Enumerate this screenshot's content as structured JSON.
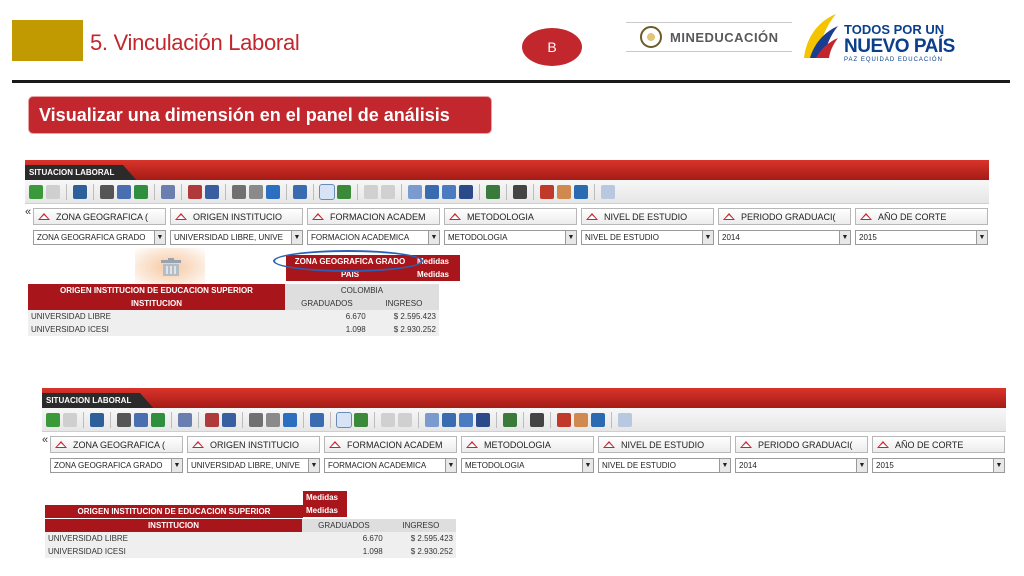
{
  "header": {
    "title": "5. Vinculación Laboral",
    "badge": "B",
    "logo_mineducacion": "MINEDUCACIÓN",
    "logo_tpu_line1": "TODOS POR UN",
    "logo_tpu_line2": "NUEVO PAÍS",
    "logo_tpu_line3": "PAZ  EQUIDAD  EDUCACIÓN"
  },
  "subtitle": "Visualizar una dimensión en el panel de análisis",
  "colors": {
    "accent_red": "#c1272d",
    "gold": "#c09a00",
    "header_dark_red": "#a8151a",
    "highlight_blue": "#2b5fb5"
  },
  "panel": {
    "tab_label": "SITUACION LABORAL",
    "collapse_glyph": "«",
    "dimensions": [
      "ZONA GEOGRAFICA (",
      "ORIGEN INSTITUCIO",
      "FORMACION ACADEM",
      "METODOLOGIA",
      "NIVEL DE ESTUDIO",
      "PERIODO GRADUACI(",
      "AÑO DE CORTE"
    ],
    "selects": [
      "ZONA GEOGRAFICA GRADO",
      "UNIVERSIDAD LIBRE, UNIVE",
      "FORMACION ACADEMICA",
      "METODOLOGIA",
      "NIVEL DE ESTUDIO",
      "2014",
      "2015"
    ],
    "toolbar_icons": [
      "undo-icon",
      "redo-icon",
      "export-icon",
      "print-icon",
      "pdf-icon",
      "excel-icon",
      "report-icon",
      "chart-icon",
      "refresh-icon",
      "bar-chart-icon",
      "link-icon",
      "axis-icon",
      "pivot-icon",
      "table-icon",
      "chart-type-icon",
      "align-left-icon",
      "align-center-icon",
      "data-icon",
      "calc-icon",
      "sum-icon",
      "books-icon",
      "settings-icon",
      "tag-icon",
      "gavel-icon",
      "pin-icon",
      "cube-icon",
      "info-icon"
    ]
  },
  "table_top": {
    "dim_label": "ZONA GEOGRAFICA GRADO",
    "measures_label": "Medidas",
    "country_dim": "PAIS",
    "row_dim_1": "ORIGEN INSTITUCION DE EDUCACION SUPERIOR",
    "country": "COLOMBIA",
    "row_dim_2": "INSTITUCION",
    "col_1": "GRADUADOS",
    "col_2": "INGRESO",
    "rows": [
      {
        "name": "UNIVERSIDAD LIBRE",
        "graduados": "6.670",
        "ingreso": "$ 2.595.423"
      },
      {
        "name": "UNIVERSIDAD ICESI",
        "graduados": "1.098",
        "ingreso": "$ 2.930.252"
      }
    ]
  },
  "table_bottom": {
    "measures_label": "Medidas",
    "row_dim_1": "ORIGEN INSTITUCION DE EDUCACION SUPERIOR",
    "row_dim_2": "INSTITUCION",
    "col_1": "GRADUADOS",
    "col_2": "INGRESO",
    "rows": [
      {
        "name": "UNIVERSIDAD LIBRE",
        "graduados": "6.670",
        "ingreso": "$ 2.595.423"
      },
      {
        "name": "UNIVERSIDAD ICESI",
        "graduados": "1.098",
        "ingreso": "$ 2.930.252"
      }
    ]
  }
}
